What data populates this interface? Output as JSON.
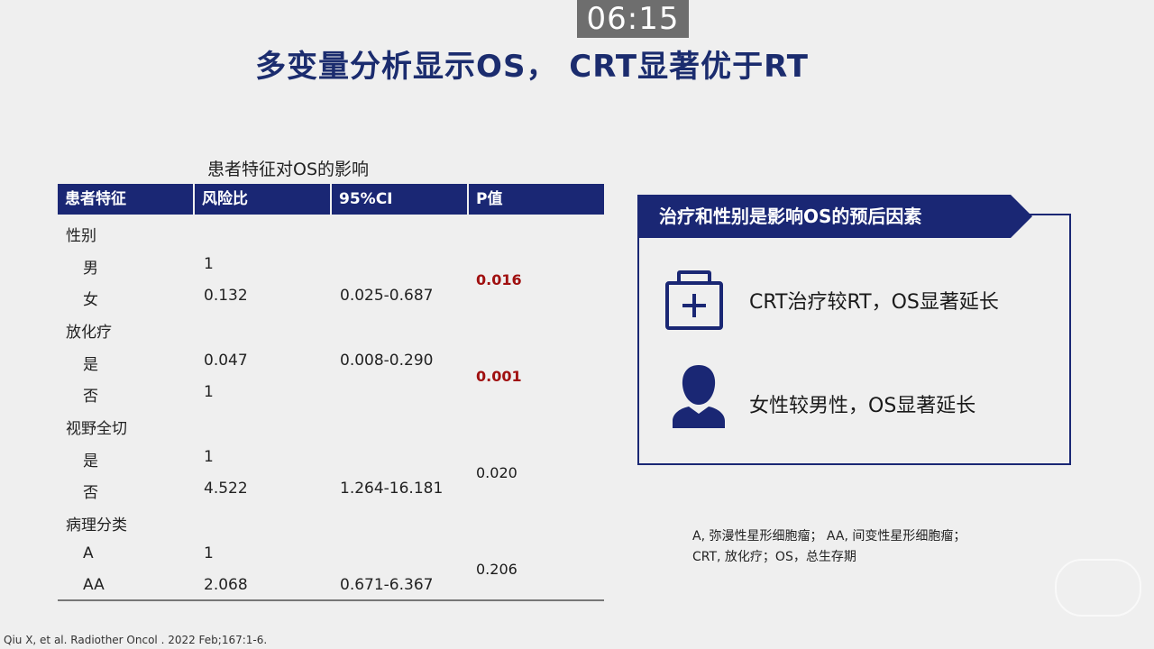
{
  "timer": "06:15",
  "title": "多变量分析显示OS， CRT显著优于RT",
  "table": {
    "caption": "患者特征对OS的影响",
    "headers": [
      "患者特征",
      "风险比",
      "95%CI",
      "P值"
    ],
    "groups": [
      {
        "name": "性别",
        "rows": [
          {
            "label": "男",
            "hr": "1",
            "ci": ""
          },
          {
            "label": "女",
            "hr": "0.132",
            "ci": "0.025-0.687"
          }
        ],
        "p": "0.016",
        "significant": true
      },
      {
        "name": "放化疗",
        "rows": [
          {
            "label": "是",
            "hr": "0.047",
            "ci": "0.008-0.290"
          },
          {
            "label": "否",
            "hr": "1",
            "ci": ""
          }
        ],
        "p": "0.001",
        "significant": true
      },
      {
        "name": "视野全切",
        "rows": [
          {
            "label": "是",
            "hr": "1",
            "ci": ""
          },
          {
            "label": "否",
            "hr": "4.522",
            "ci": "1.264-16.181"
          }
        ],
        "p": "0.020",
        "significant": false
      },
      {
        "name": "病理分类",
        "rows": [
          {
            "label": "A",
            "hr": "1",
            "ci": ""
          },
          {
            "label": "AA",
            "hr": "2.068",
            "ci": "0.671-6.367"
          }
        ],
        "p": "0.206",
        "significant": false
      }
    ]
  },
  "summary": {
    "heading": "治疗和性别是影响OS的预后因素",
    "points": [
      {
        "icon": "medical-kit-icon",
        "text": "CRT治疗较RT，OS显著延长"
      },
      {
        "icon": "person-icon",
        "text": "女性较男性，OS显著延长"
      }
    ]
  },
  "footnote": {
    "line1": "A, 弥漫性星形细胞瘤； AA, 间变性星形细胞瘤；",
    "line2": "CRT, 放化疗；OS，总生存期"
  },
  "citation": "Qiu X, et al. Radiother Oncol . 2022 Feb;167:1-6.",
  "watermark": "",
  "colors": {
    "brand_navy": "#1a2774",
    "significant_red": "#a01010",
    "background": "#efefef"
  }
}
